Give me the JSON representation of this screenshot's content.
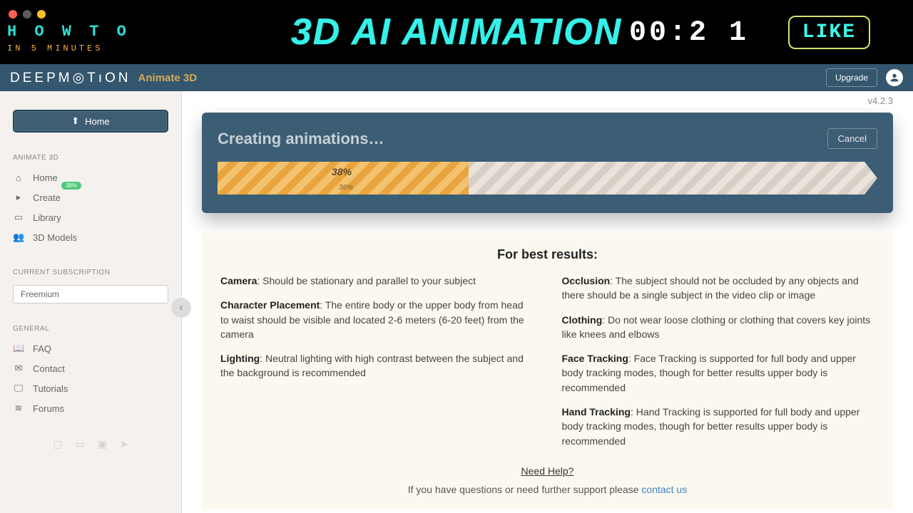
{
  "banner": {
    "howto_top": "H O W   T O",
    "howto_bottom": "IN 5 MINUTES",
    "title": "3D AI ANIMATION",
    "timer": "00:2 1",
    "like": "LIKE"
  },
  "header": {
    "logo": "DEEPM◎TıON",
    "product": "Animate 3D",
    "upgrade": "Upgrade"
  },
  "sidebar": {
    "home_button": "Home",
    "sections": {
      "animate": "ANIMATE 3D",
      "subscription": "CURRENT SUBSCRIPTION",
      "general": "GENERAL"
    },
    "nav_animate": [
      {
        "icon": "⌂",
        "label": "Home"
      },
      {
        "icon": "▸",
        "label": "Create",
        "badge": "38%"
      },
      {
        "icon": "▭",
        "label": "Library"
      },
      {
        "icon": "👥",
        "label": "3D Models"
      }
    ],
    "subscription_value": "Freemium",
    "nav_general": [
      {
        "icon": "📖",
        "label": "FAQ"
      },
      {
        "icon": "✉",
        "label": "Contact"
      },
      {
        "icon": "🖵",
        "label": "Tutorials"
      },
      {
        "icon": "≋",
        "label": "Forums"
      }
    ]
  },
  "main": {
    "version": "v4.2.3",
    "progress": {
      "title": "Creating animations…",
      "cancel": "Cancel",
      "percent_label": "38%",
      "percent_value": 38
    },
    "tips": {
      "title": "For best results:",
      "left": [
        {
          "term": "Camera",
          "text": ": Should be stationary and parallel to your subject"
        },
        {
          "term": "Character Placement",
          "text": ": The entire body or the upper body from head to waist should be visible and located 2-6 meters (6-20 feet) from the camera"
        },
        {
          "term": "Lighting",
          "text": ": Neutral lighting with high contrast between the subject and the background is recommended"
        }
      ],
      "right": [
        {
          "term": "Occlusion",
          "text": ": The subject should not be occluded by any objects and there should be a single subject in the video clip or image"
        },
        {
          "term": "Clothing",
          "text": ": Do not wear loose clothing or clothing that covers key joints like knees and elbows"
        },
        {
          "term": "Face Tracking",
          "text": ": Face Tracking is supported for full body and upper body tracking modes, though for better results upper body is recommended"
        },
        {
          "term": "Hand Tracking",
          "text": ": Hand Tracking is supported for full body and upper body tracking modes, though for better results upper body is recommended"
        }
      ],
      "need_help": "Need Help?",
      "support_prefix": "If you have questions or need further support please ",
      "support_link": "contact us"
    }
  }
}
